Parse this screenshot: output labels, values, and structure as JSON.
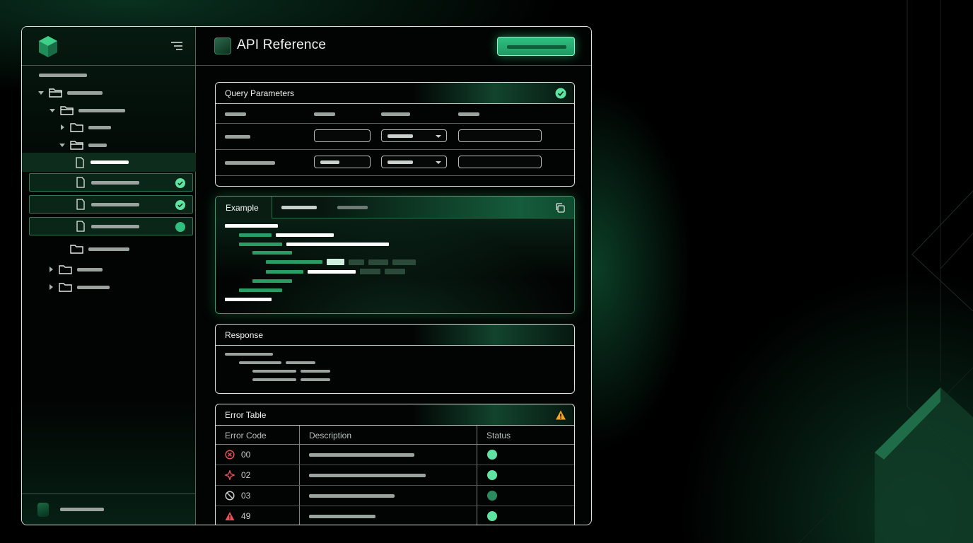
{
  "app": {
    "page_title": "API Reference",
    "logo_icon": "cube-logo-icon"
  },
  "colors": {
    "accent": "#34d68c",
    "accent_dark": "#1f8c5a",
    "warning": "#f0a22a",
    "error": "#e8505b",
    "status_ok": "#5fe3a1",
    "status_muted": "#2a8c5e"
  },
  "sidebar": {
    "menu_icon": "menu-icon",
    "files": [
      {
        "state": "active"
      },
      {
        "state": "selected",
        "status": "check"
      },
      {
        "state": "selected",
        "status": "check"
      },
      {
        "state": "selected",
        "status": "dot"
      }
    ]
  },
  "panels": {
    "query_params": {
      "title": "Query Parameters",
      "status_icon": "check-circle-icon"
    },
    "example": {
      "tabs": [
        {
          "label": "Example",
          "active": true
        }
      ],
      "copy_icon": "copy-icon"
    },
    "response": {
      "title": "Response"
    },
    "error_table": {
      "title": "Error Table",
      "status_icon": "warning-icon",
      "columns": [
        "Error Code",
        "Description",
        "Status"
      ],
      "rows": [
        {
          "icon": "error-circle-icon",
          "code": "00",
          "status": "ok"
        },
        {
          "icon": "burst-icon",
          "code": "02",
          "status": "ok"
        },
        {
          "icon": "blocked-icon",
          "code": "03",
          "status": "muted"
        },
        {
          "icon": "warning-icon",
          "code": "49",
          "status": "ok"
        }
      ]
    }
  }
}
